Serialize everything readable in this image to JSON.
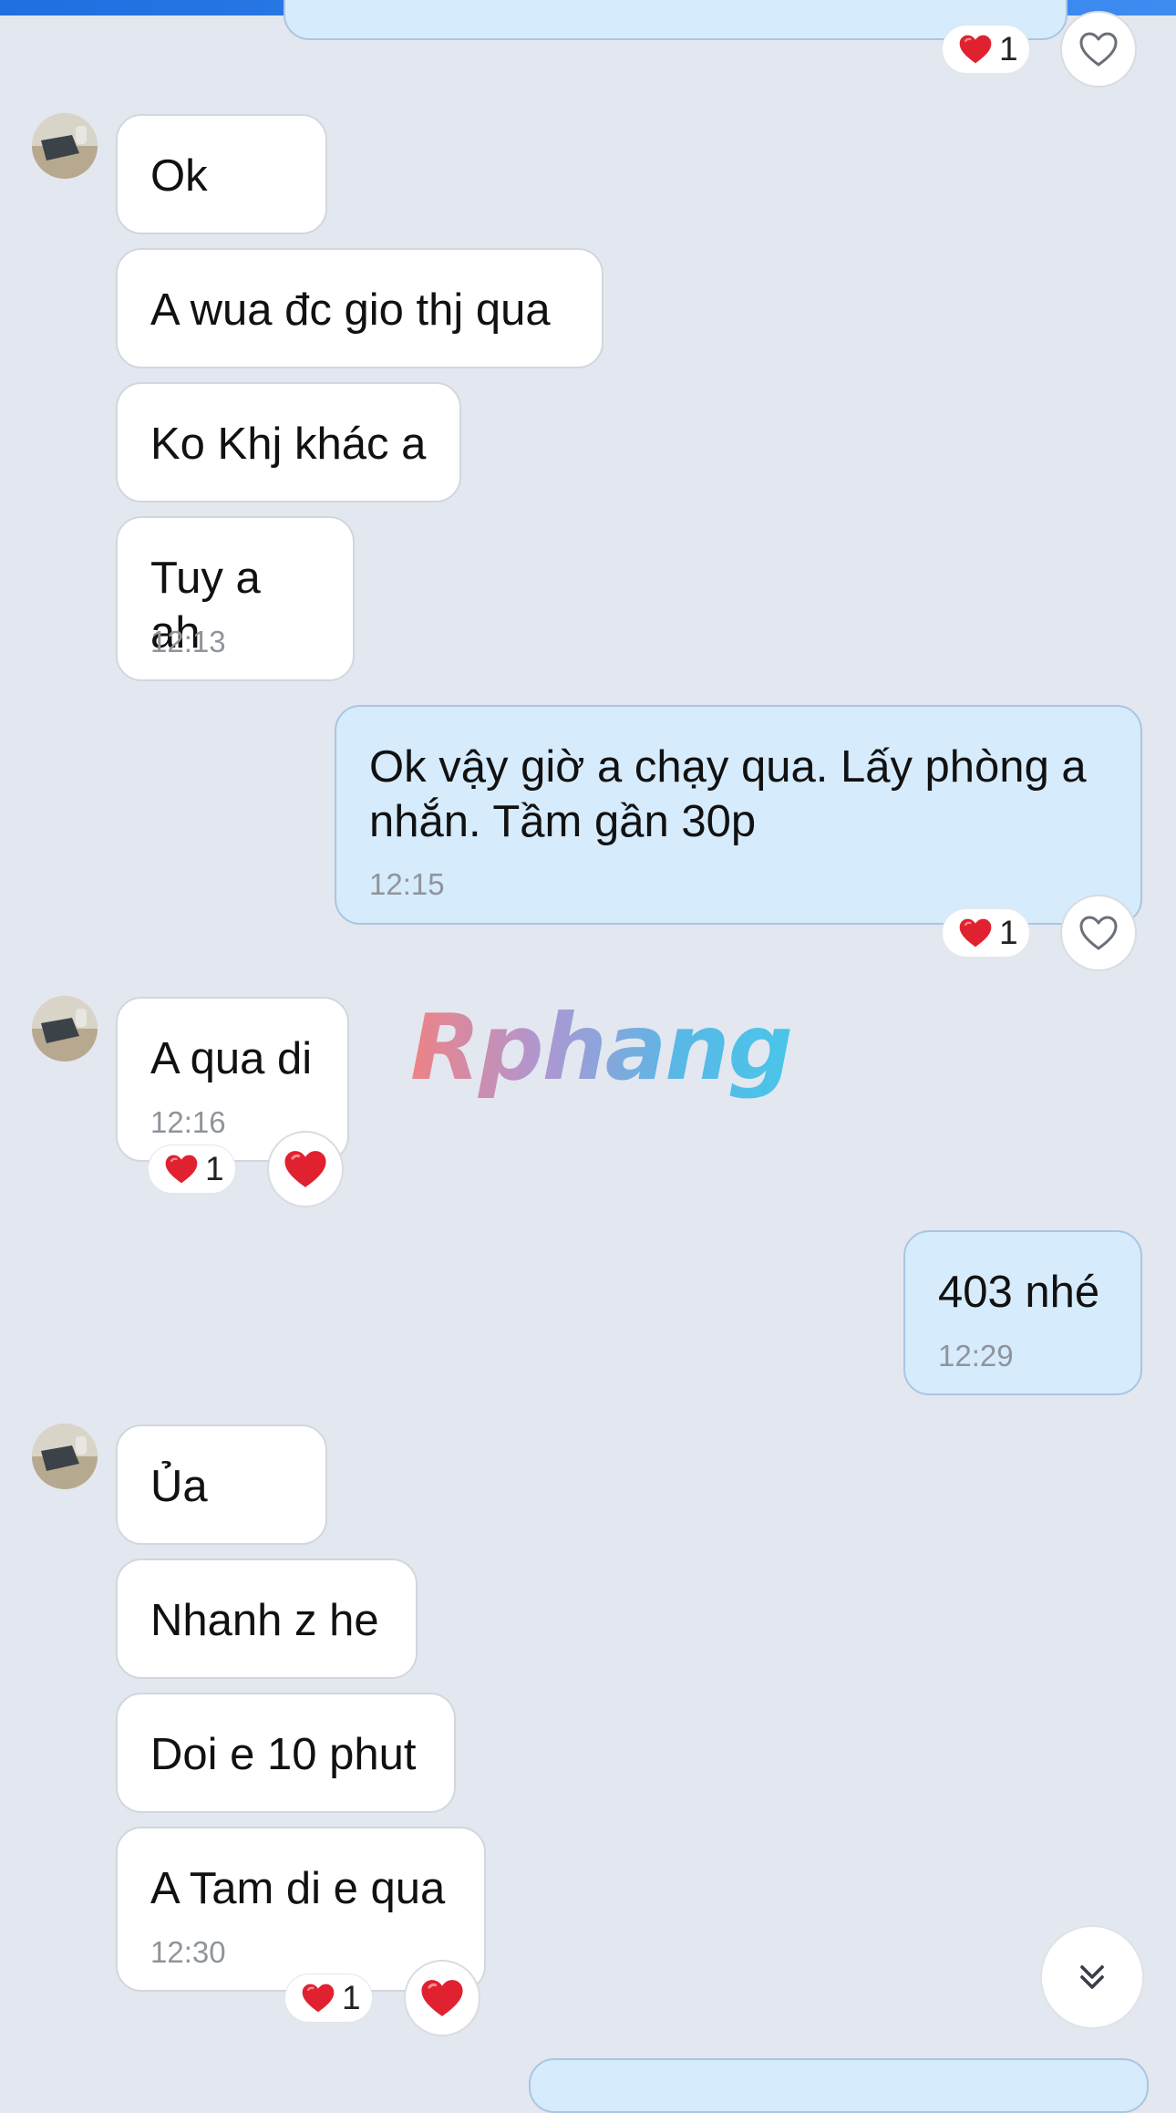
{
  "messages": {
    "m1": {
      "text": "Ok"
    },
    "m2": {
      "text": "A wua đc gio thj qua"
    },
    "m3": {
      "text": "Ko Khj khác a"
    },
    "m4": {
      "text": "Tuy a ah",
      "time": "12:13"
    },
    "m5": {
      "text": "Ok vậy giờ a chạy qua. Lấy phòng a nhắn. Tầm gần 30p",
      "time": "12:15"
    },
    "m6": {
      "text": "A qua di",
      "time": "12:16"
    },
    "m7": {
      "text": "403 nhé",
      "time": "12:29"
    },
    "m8": {
      "text": "Ủa"
    },
    "m9": {
      "text": "Nhanh z he"
    },
    "m10": {
      "text": "Doi e 10 phut"
    },
    "m11": {
      "text": "A Tam di e qua",
      "time": "12:30"
    }
  },
  "reactions": {
    "top": {
      "count": "1"
    },
    "m5": {
      "count": "1"
    },
    "m6": {
      "count": "1"
    },
    "m11": {
      "count": "1"
    }
  },
  "watermark": {
    "text": "Rphang"
  },
  "colors": {
    "background": "#e3e7ef",
    "incoming_bubble": "#ffffff",
    "outgoing_bubble": "#d6ebfb",
    "heart": "#e02230",
    "timestamp": "#8f949c"
  }
}
